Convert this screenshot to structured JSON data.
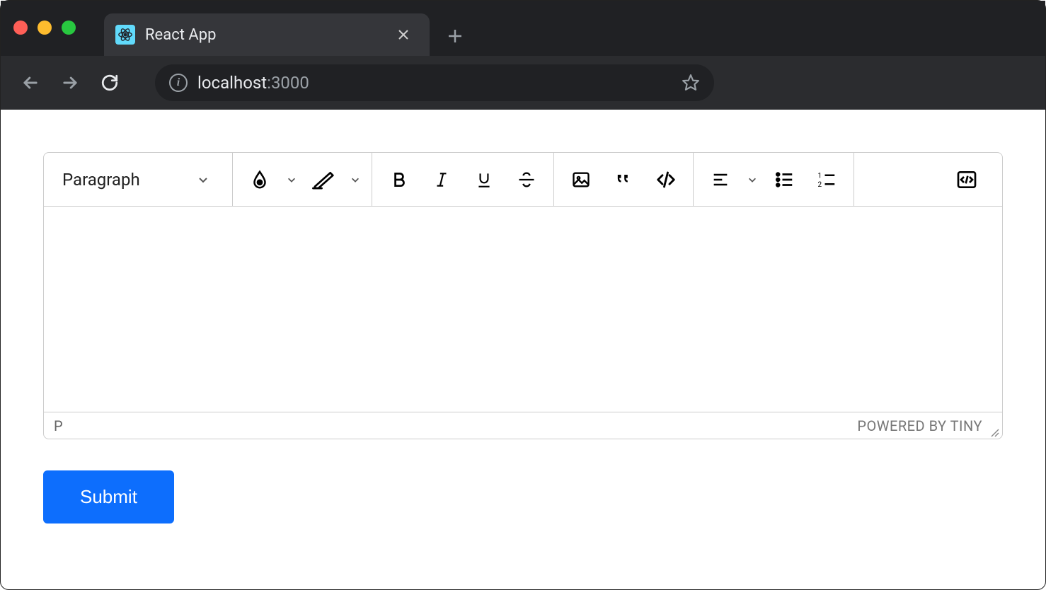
{
  "browser": {
    "tab": {
      "title": "React App"
    },
    "url": {
      "host": "localhost",
      "port": ":3000"
    }
  },
  "editor": {
    "format_label": "Paragraph",
    "status_path": "P",
    "branding": "POWERED BY TINY"
  },
  "buttons": {
    "submit": "Submit"
  }
}
